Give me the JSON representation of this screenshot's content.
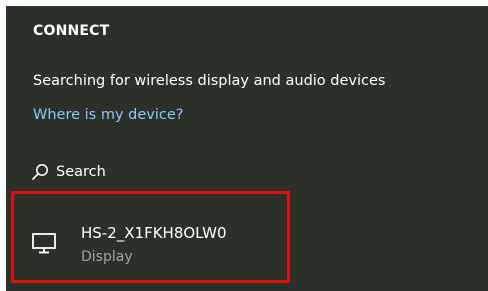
{
  "panel": {
    "title": "CONNECT",
    "status": "Searching for wireless display and audio devices",
    "help_link": "Where is my device?",
    "search_label": "Search"
  },
  "devices": [
    {
      "name": "HS-2_X1FKH8OLW0",
      "type": "Display",
      "icon": "monitor-icon"
    }
  ],
  "colors": {
    "background": "#2b3129",
    "link": "#8cc8ff",
    "highlight_border": "#e01010",
    "secondary_text": "#a0a7a0"
  },
  "icons": {
    "search": "search-icon",
    "device": "monitor-icon"
  }
}
